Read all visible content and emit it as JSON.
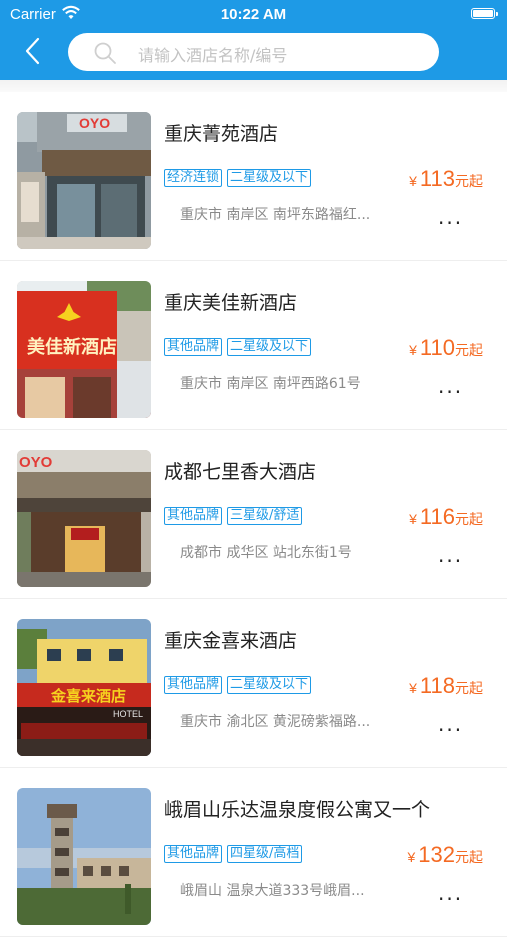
{
  "status_bar": {
    "carrier": "Carrier",
    "time": "10:22 AM"
  },
  "search": {
    "placeholder": "请输入酒店名称/编号"
  },
  "hotels": [
    {
      "name": "重庆菁苑酒店",
      "tags": [
        "经济连锁",
        "二星级及以下"
      ],
      "currency": "¥",
      "price": "113",
      "price_suffix": "元起",
      "address": "重庆市  南岸区  南坪东路福红...",
      "more": "..."
    },
    {
      "name": "重庆美佳新酒店",
      "tags": [
        "其他品牌",
        "二星级及以下"
      ],
      "currency": "¥",
      "price": "110",
      "price_suffix": "元起",
      "address": "重庆市  南岸区  南坪西路61号",
      "more": "..."
    },
    {
      "name": "成都七里香大酒店",
      "tags": [
        "其他品牌",
        "三星级/舒适"
      ],
      "currency": "¥",
      "price": "116",
      "price_suffix": "元起",
      "address": "成都市  成华区  站北东街1号",
      "more": "..."
    },
    {
      "name": "重庆金喜来酒店",
      "tags": [
        "其他品牌",
        "二星级及以下"
      ],
      "currency": "¥",
      "price": "118",
      "price_suffix": "元起",
      "address": "重庆市  渝北区  黄泥磅紫福路...",
      "more": "..."
    },
    {
      "name": "峨眉山乐达温泉度假公寓又一个",
      "tags": [
        "其他品牌",
        "四星级/高档"
      ],
      "currency": "¥",
      "price": "132",
      "price_suffix": "元起",
      "address": "峨眉山  温泉大道333号峨眉...",
      "more": "..."
    }
  ],
  "image_text": {
    "hotel_1_sign": "OYO",
    "hotel_2_sign": "美佳新酒店",
    "hotel_3_sign": "OYO",
    "hotel_4_sign": "金喜来酒店",
    "hotel_4_sign_en": "HOTEL"
  },
  "colors": {
    "accent": "#1e9ae6",
    "price": "#f46a23"
  },
  "icons": {
    "back": "chevron-left-icon",
    "search": "search-icon",
    "wifi": "wifi-icon",
    "battery": "battery-icon",
    "more": "ellipsis-icon"
  }
}
